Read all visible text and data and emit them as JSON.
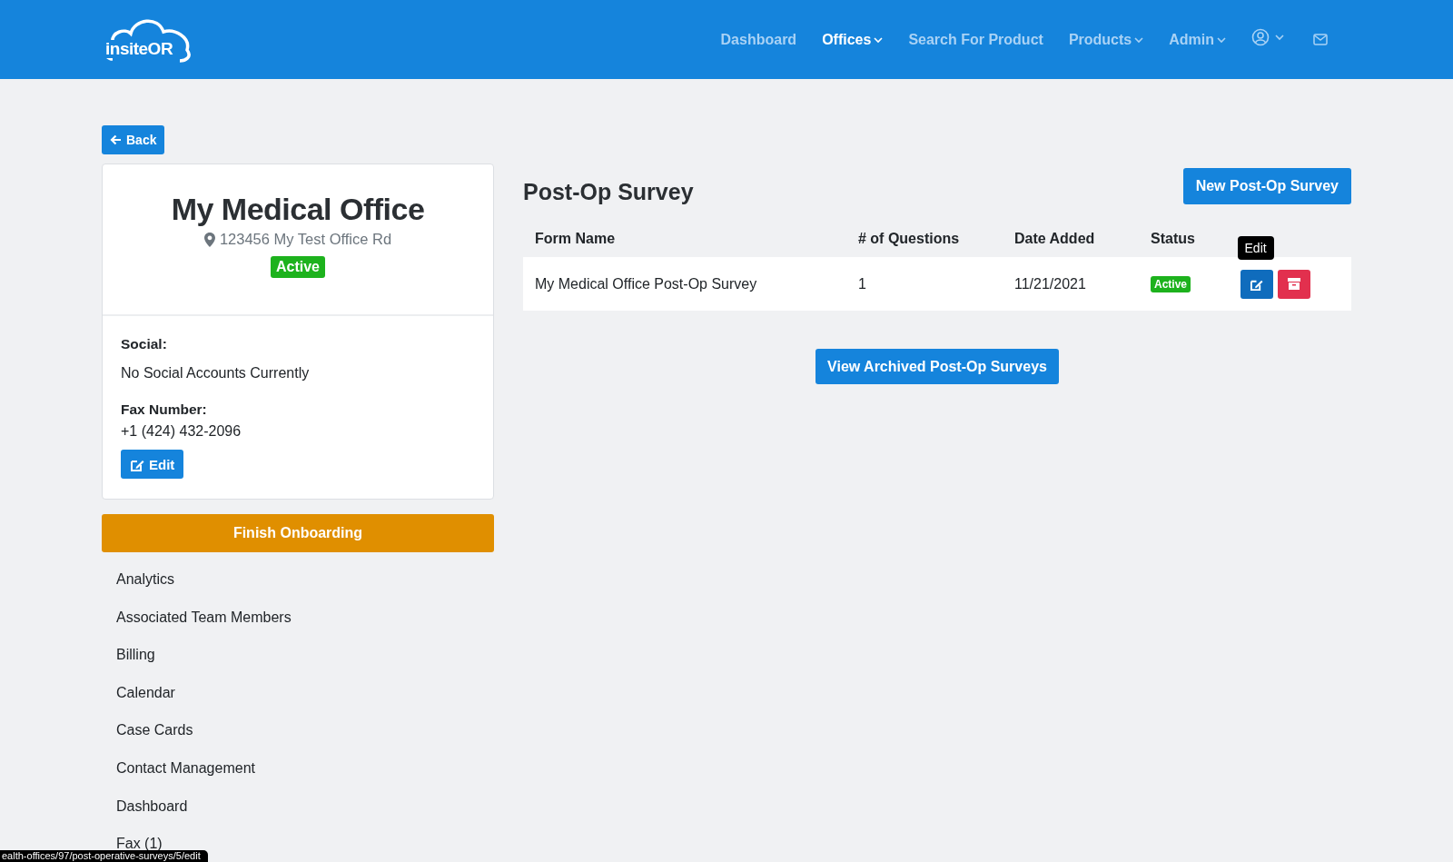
{
  "header": {
    "logo": "insiteOR",
    "nav": [
      {
        "label": "Dashboard",
        "selected": false,
        "dropdown": false
      },
      {
        "label": "Offices",
        "selected": true,
        "dropdown": true
      },
      {
        "label": "Search For Product",
        "selected": false,
        "dropdown": false
      },
      {
        "label": "Products",
        "selected": false,
        "dropdown": true
      },
      {
        "label": "Admin",
        "selected": false,
        "dropdown": true
      }
    ]
  },
  "back_button": "Back",
  "office": {
    "name": "My Medical Office",
    "address": "123456 My Test Office Rd",
    "status": "Active",
    "social_label": "Social:",
    "social_value": "No Social Accounts Currently",
    "fax_label": "Fax Number:",
    "fax_value": "+1 (424) 432-2096",
    "edit_button": "Edit"
  },
  "finish_button": "Finish Onboarding",
  "sidebar": {
    "items": [
      "Analytics",
      "Associated Team Members",
      "Billing",
      "Calendar",
      "Case Cards",
      "Contact Management",
      "Dashboard",
      "Fax (1)"
    ]
  },
  "survey": {
    "title": "Post-Op Survey",
    "new_button": "New Post-Op Survey",
    "table": {
      "columns": [
        "Form Name",
        "# of Questions",
        "Date Added",
        "Status"
      ],
      "rows": [
        {
          "form_name": "My Medical Office Post-Op Survey",
          "questions": "1",
          "date_added": "11/21/2021",
          "status": "Active",
          "edit_tooltip": "Edit"
        }
      ]
    },
    "archived_button": "View Archived Post-Op Surveys"
  },
  "status_bar": "ealth-offices/97/post-operative-surveys/5/edit"
}
